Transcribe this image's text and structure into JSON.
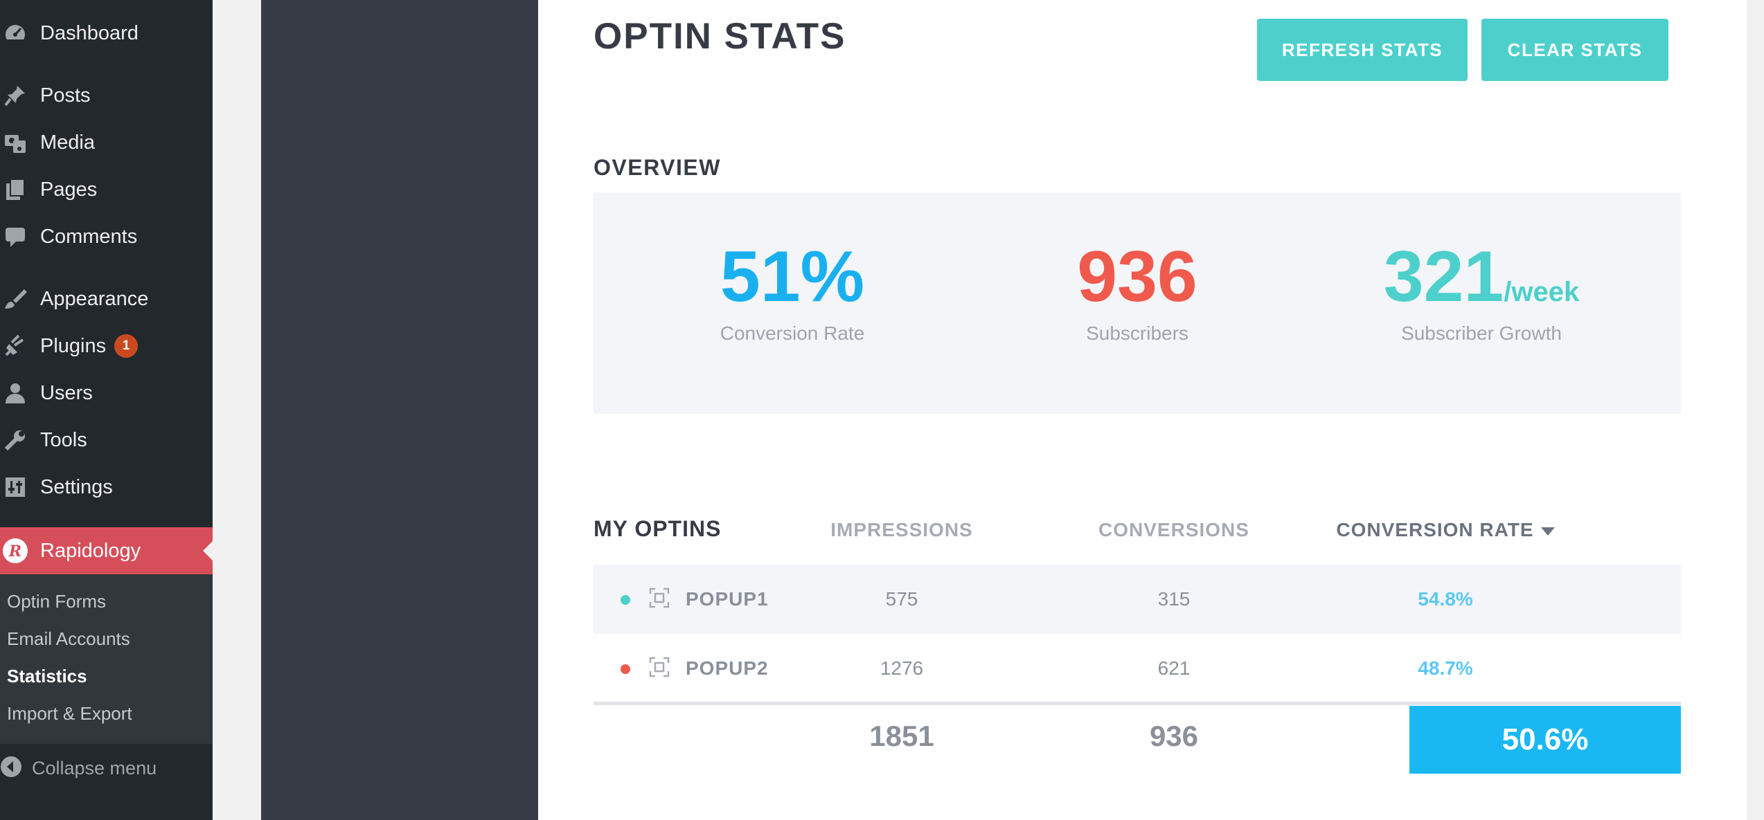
{
  "sidebar": {
    "items": [
      {
        "label": "Dashboard",
        "icon": "dashboard-icon"
      },
      {
        "label": "Posts",
        "icon": "pin-icon"
      },
      {
        "label": "Media",
        "icon": "media-icon"
      },
      {
        "label": "Pages",
        "icon": "pages-icon"
      },
      {
        "label": "Comments",
        "icon": "comment-icon"
      },
      {
        "label": "Appearance",
        "icon": "paintbrush-icon"
      },
      {
        "label": "Plugins",
        "icon": "plugin-icon",
        "badge": "1"
      },
      {
        "label": "Users",
        "icon": "user-icon"
      },
      {
        "label": "Tools",
        "icon": "wrench-icon"
      },
      {
        "label": "Settings",
        "icon": "settings-icon"
      },
      {
        "label": "Rapidology",
        "icon": "rapidology-logo-icon",
        "active": true
      }
    ],
    "submenu": [
      {
        "label": "Optin Forms"
      },
      {
        "label": "Email Accounts"
      },
      {
        "label": "Statistics",
        "current": true
      },
      {
        "label": "Import & Export"
      }
    ],
    "collapse_label": "Collapse menu",
    "active_color": "#d54e59"
  },
  "header": {
    "title": "OPTIN STATS",
    "refresh_label": "REFRESH STATS",
    "clear_label": "CLEAR STATS",
    "button_color": "#4dd0cc"
  },
  "overview": {
    "heading": "OVERVIEW",
    "conversion_rate": {
      "value": "51%",
      "label": "Conversion Rate",
      "color": "#1ab0f0"
    },
    "subscribers": {
      "value": "936",
      "label": "Subscribers",
      "color": "#ef5a4c"
    },
    "growth": {
      "value": "321",
      "unit": "/week",
      "label": "Subscriber Growth",
      "color": "#4dd0cc"
    }
  },
  "optins": {
    "heading": "MY OPTINS",
    "columns": {
      "impressions": "IMPRESSIONS",
      "conversions": "CONVERSIONS",
      "rate": "CONVERSION RATE"
    },
    "rows": [
      {
        "name": "POPUP1",
        "status_color": "#4dd0cc",
        "impressions": "575",
        "conversions": "315",
        "rate": "54.8%"
      },
      {
        "name": "POPUP2",
        "status_color": "#ef5a4c",
        "impressions": "1276",
        "conversions": "621",
        "rate": "48.7%"
      }
    ],
    "totals": {
      "impressions": "1851",
      "conversions": "936",
      "rate": "50.6%"
    }
  }
}
